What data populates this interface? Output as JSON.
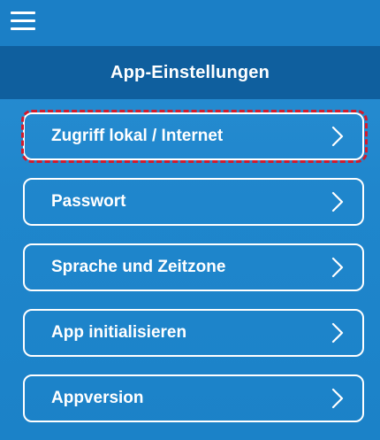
{
  "header": {
    "menu_icon": "hamburger-menu-icon",
    "title": "App-Einstellungen"
  },
  "menu": {
    "items": [
      {
        "label": "Zugriff lokal / Internet",
        "icon": "chevron-right-icon",
        "highlighted": true
      },
      {
        "label": "Passwort",
        "icon": "chevron-right-icon"
      },
      {
        "label": "Sprache und Zeitzone",
        "icon": "chevron-right-icon"
      },
      {
        "label": "App initialisieren",
        "icon": "chevron-right-icon"
      },
      {
        "label": "Appversion",
        "icon": "chevron-right-icon"
      }
    ]
  },
  "colors": {
    "background": "#1f86cc",
    "titlebar": "#0f5f9e",
    "highlight_outline": "#d41a2b",
    "text": "#ffffff"
  }
}
